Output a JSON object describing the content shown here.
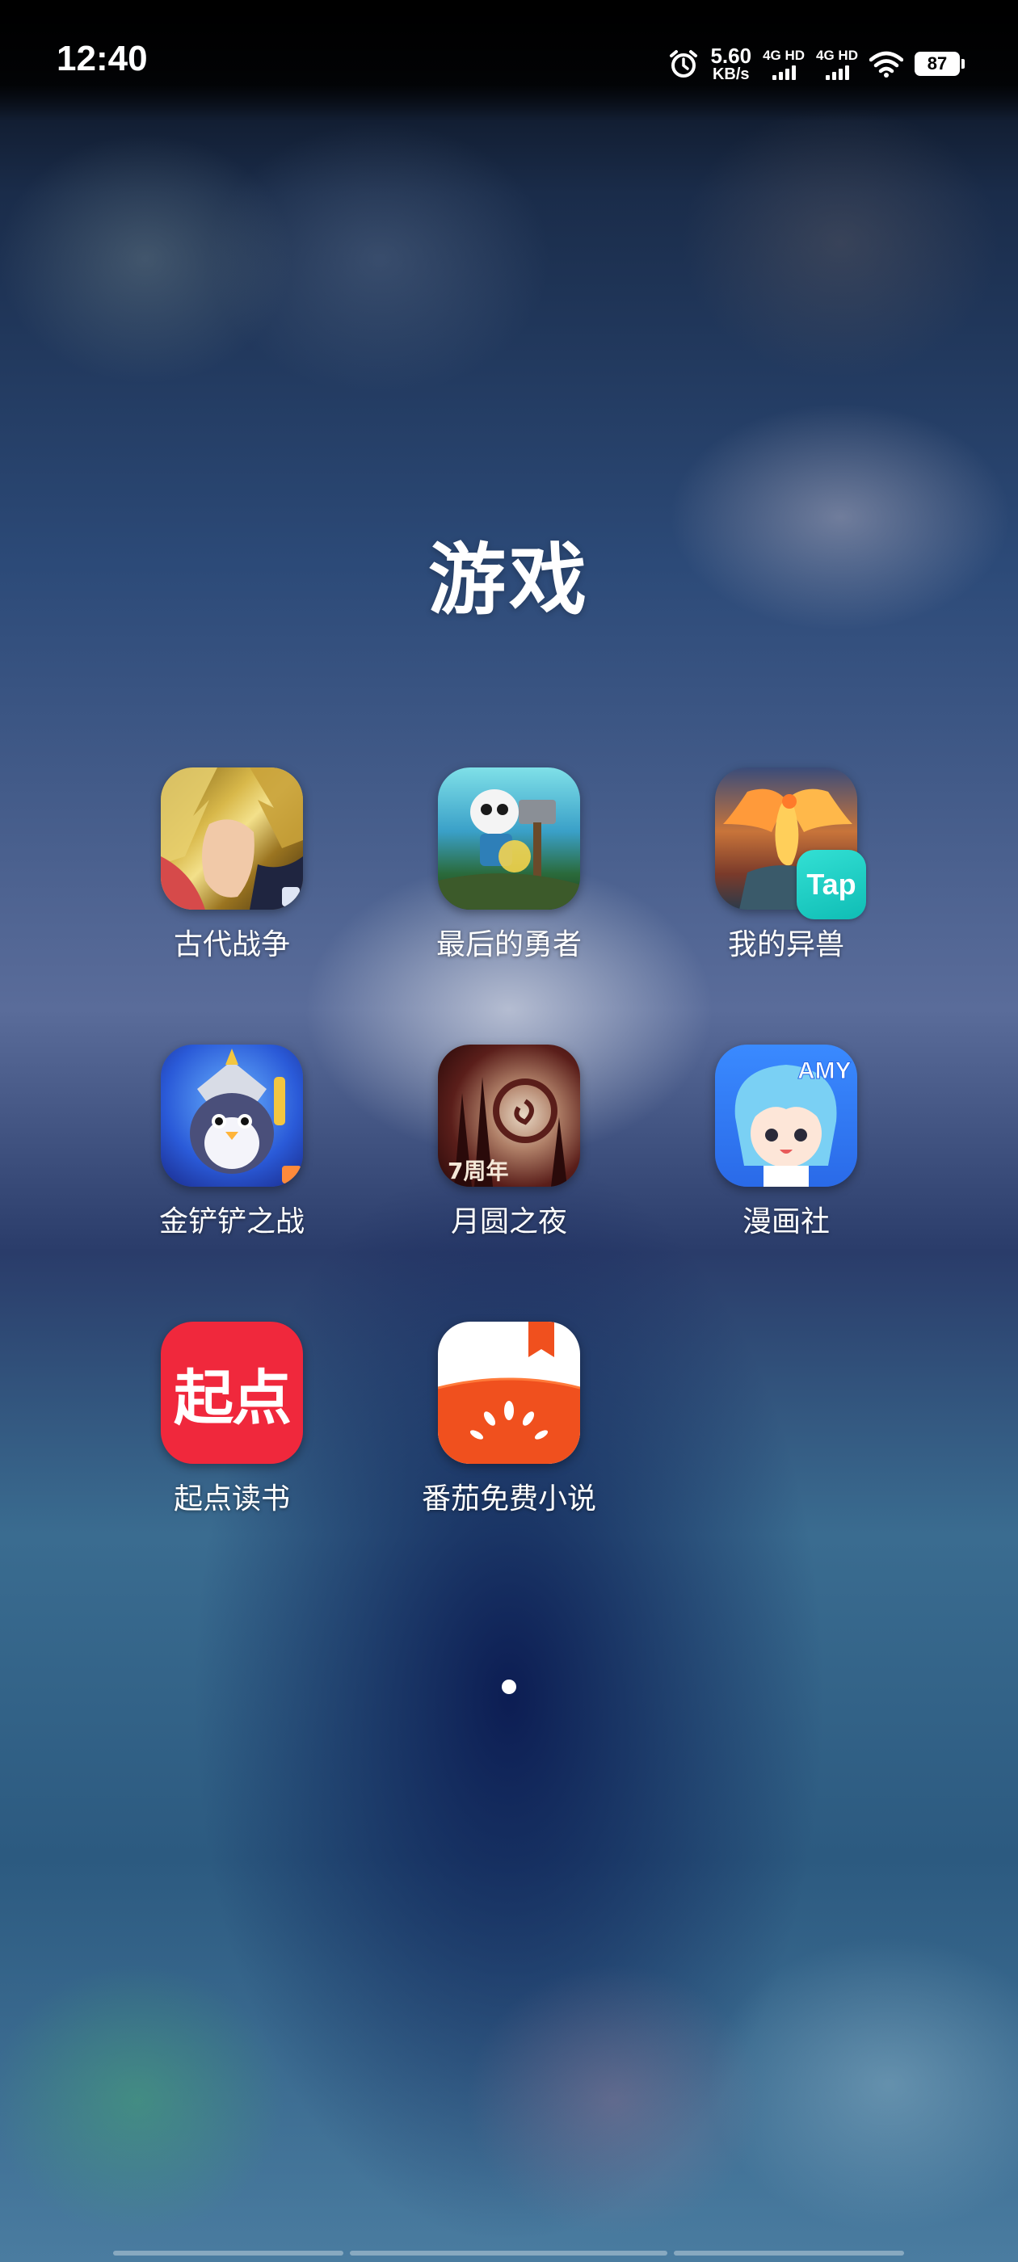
{
  "status_bar": {
    "time": "12:40",
    "net_speed_value": "5.60",
    "net_speed_unit": "KB/s",
    "sim1_label": "4G HD",
    "sim2_label": "4G HD",
    "battery_level": "87",
    "icons": [
      "alarm-icon",
      "signal-icon",
      "signal-icon",
      "wifi-icon",
      "battery-icon"
    ]
  },
  "folder": {
    "title": "游戏",
    "apps": [
      {
        "name": "古代战争",
        "icon": "ancient-war-app-icon"
      },
      {
        "name": "最后的勇者",
        "icon": "last-hero-app-icon"
      },
      {
        "name": "我的异兽",
        "icon": "my-beast-app-icon",
        "badge": "Tap"
      },
      {
        "name": "金铲铲之战",
        "icon": "golden-spatula-app-icon"
      },
      {
        "name": "月圆之夜",
        "icon": "full-moon-night-app-icon",
        "icon_text": "7周年"
      },
      {
        "name": "漫画社",
        "icon": "manga-club-app-icon",
        "icon_text": "AMY"
      },
      {
        "name": "起点读书",
        "icon": "qidian-reading-app-icon",
        "icon_text": "起点"
      },
      {
        "name": "番茄免费小说",
        "icon": "tomato-novel-app-icon"
      }
    ]
  },
  "pager": {
    "pages": 1,
    "current": 1
  }
}
